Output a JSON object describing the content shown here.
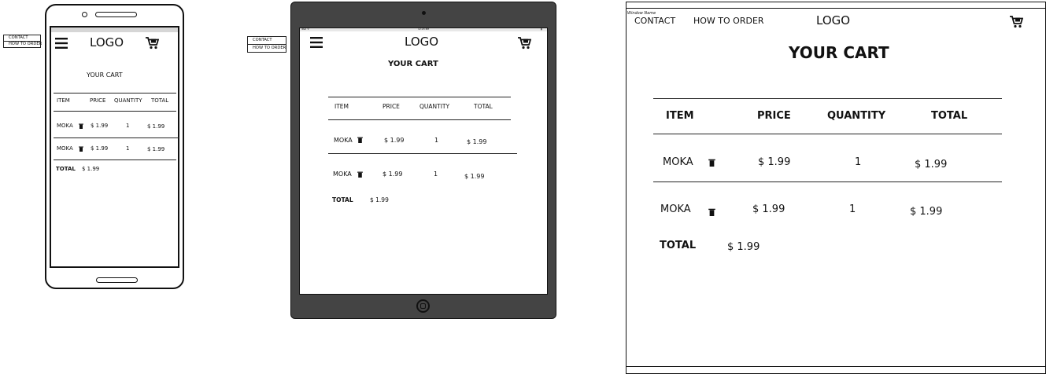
{
  "logo": "LOGO",
  "cart_title": "YOUR CART",
  "menu": {
    "contact": "CONTACT",
    "how_to_order": "HOW TO ORDER"
  },
  "window_title": "Window Name",
  "tablet_status": {
    "left": "iPad ᯤ",
    "time": "12:23 PM",
    "right": "▮"
  },
  "table": {
    "headers": [
      "ITEM",
      "PRICE",
      "QUANTITY",
      "TOTAL"
    ],
    "rows": [
      {
        "item": "MOKA",
        "price": "$ 1.99",
        "quantity": "1",
        "total": "$ 1.99"
      },
      {
        "item": "MOKA",
        "price": "$ 1.99",
        "quantity": "1",
        "total": "$ 1.99"
      }
    ],
    "total_label": "TOTAL",
    "total_value": "$ 1.99"
  },
  "icons": {
    "menu": "hamburger-icon",
    "cart": "cart-icon",
    "delete": "trash-icon"
  }
}
